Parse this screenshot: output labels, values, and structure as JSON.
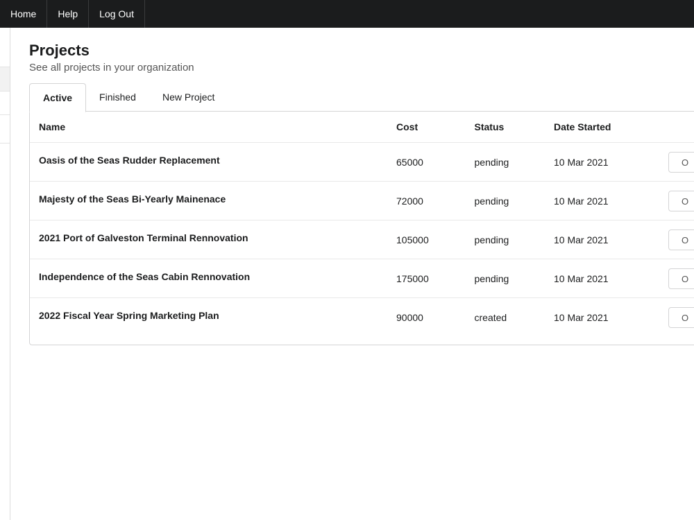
{
  "nav": {
    "items": [
      "Home",
      "Help",
      "Log Out"
    ]
  },
  "page": {
    "title": "Projects",
    "subtitle": "See all projects in your organization"
  },
  "tabs": [
    {
      "label": "Active",
      "active": true
    },
    {
      "label": "Finished",
      "active": false
    },
    {
      "label": "New Project",
      "active": false
    }
  ],
  "table": {
    "headers": [
      "Name",
      "Cost",
      "Status",
      "Date Started"
    ],
    "rows": [
      {
        "name": "Oasis of the Seas Rudder Replacement",
        "cost": "65000",
        "status": "pending",
        "date": "10 Mar 2021",
        "action": "O"
      },
      {
        "name": "Majesty of the Seas Bi-Yearly Mainenace",
        "cost": "72000",
        "status": "pending",
        "date": "10 Mar 2021",
        "action": "O"
      },
      {
        "name": "2021 Port of Galveston Terminal Rennovation",
        "cost": "105000",
        "status": "pending",
        "date": "10 Mar 2021",
        "action": "O"
      },
      {
        "name": "Independence of the Seas Cabin Rennovation",
        "cost": "175000",
        "status": "pending",
        "date": "10 Mar 2021",
        "action": "O"
      },
      {
        "name": "2022 Fiscal Year Spring Marketing Plan",
        "cost": "90000",
        "status": "created",
        "date": "10 Mar 2021",
        "action": "O"
      }
    ]
  },
  "colors": {
    "topbar": "#1b1c1d",
    "border": "#d4d4d5"
  }
}
